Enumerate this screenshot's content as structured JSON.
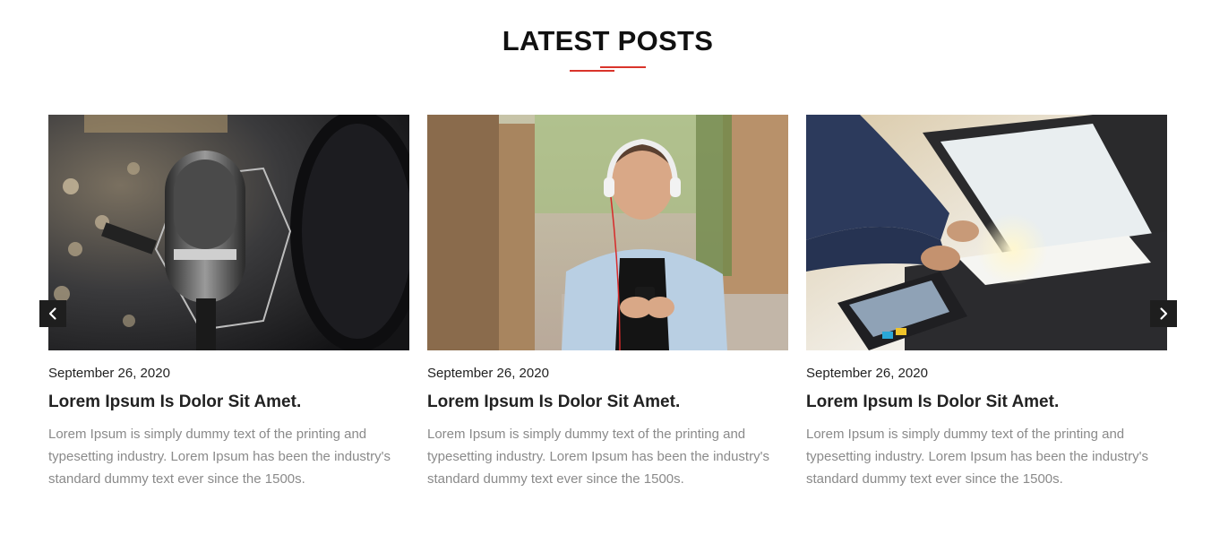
{
  "section": {
    "title": "LATEST POSTS",
    "accent_color": "#d9342b"
  },
  "carousel": {
    "prev_icon": "chevron-left-icon",
    "next_icon": "chevron-right-icon",
    "posts": [
      {
        "image": "studio-microphone-photo",
        "date": "September 26, 2020",
        "title": "Lorem Ipsum Is Dolor Sit Amet.",
        "excerpt": "Lorem Ipsum is simply dummy text of the printing and typesetting industry. Lorem Ipsum has been the industry's standard dummy text ever since the 1500s."
      },
      {
        "image": "man-with-headphones-photo",
        "date": "September 26, 2020",
        "title": "Lorem Ipsum Is Dolor Sit Amet.",
        "excerpt": "Lorem Ipsum is simply dummy text of the printing and typesetting industry. Lorem Ipsum has been the industry's standard dummy text ever since the 1500s."
      },
      {
        "image": "office-photocopier-photo",
        "date": "September 26, 2020",
        "title": "Lorem Ipsum Is Dolor Sit Amet.",
        "excerpt": "Lorem Ipsum is simply dummy text of the printing and typesetting industry. Lorem Ipsum has been the industry's standard dummy text ever since the 1500s."
      }
    ]
  }
}
